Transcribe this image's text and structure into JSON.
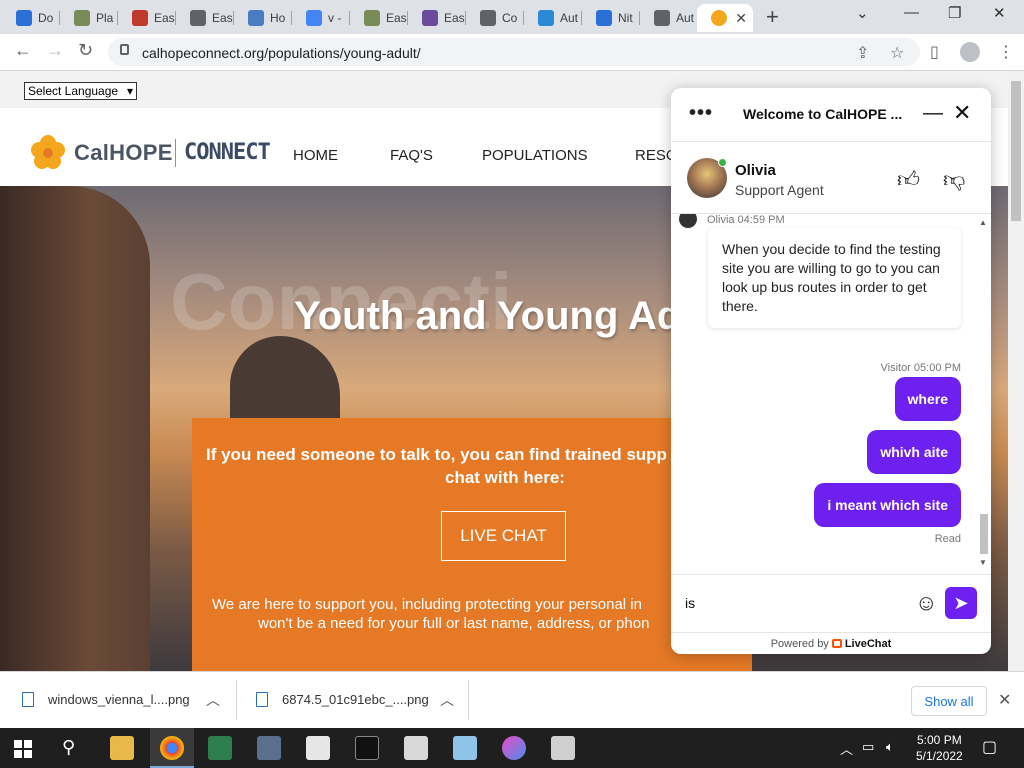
{
  "browser": {
    "tabs": [
      {
        "label": "Do",
        "color": "#2a6fd6",
        "icon": "app-icon"
      },
      {
        "label": "Pla",
        "color": "#7a8b5a",
        "icon": "game-icon"
      },
      {
        "label": "Eas",
        "color": "#c0392b",
        "icon": "game-icon"
      },
      {
        "label": "Eas",
        "color": "#5f6368",
        "icon": "globe-icon"
      },
      {
        "label": "Ho",
        "color": "#4a7cc4",
        "icon": "app-icon"
      },
      {
        "label": "v -",
        "color": "#4285f4",
        "icon": "google-icon"
      },
      {
        "label": "Eas",
        "color": "#7a8b5a",
        "icon": "game-icon"
      },
      {
        "label": "Eas",
        "color": "#6a4c9c",
        "icon": "game-icon"
      },
      {
        "label": "Co",
        "color": "#5f6368",
        "icon": "globe-icon"
      },
      {
        "label": "Aut",
        "color": "#2a8ad6",
        "icon": "app-icon"
      },
      {
        "label": "Nit",
        "color": "#2a6fd6",
        "icon": "flame-icon"
      },
      {
        "label": "Aut",
        "color": "#5f6368",
        "icon": "globe-icon"
      }
    ],
    "active_tab_color": "#f4a71d",
    "url": "calhopeconnect.org/populations/young-adult/"
  },
  "page": {
    "language_select": "Select Language",
    "logo_text": "CalHOPE",
    "logo_connect": "CONNECT",
    "nav": [
      "HOME",
      "FAQ'S",
      "POPULATIONS",
      "RESO"
    ],
    "hero_ghost": "Connecti",
    "hero_title": "Youth and Young Adu",
    "orange_line1": "If you need someone to talk to, you can find trained supp",
    "orange_line2": "chat with here:",
    "live_chat_button": "LIVE CHAT",
    "orange_sub1": "We are here to support you, including protecting your personal in",
    "orange_sub2": "won't be a need for your full or last name, address, or phon",
    "accent": "#e57926"
  },
  "chat": {
    "title": "Welcome to CalHOPE ...",
    "agent_name": "Olivia",
    "agent_role": "Support Agent",
    "agent_meta": "Olivia 04:59 PM",
    "agent_message": "When you decide to find the testing site you are willing to go to you can look up bus routes in order to get there.",
    "visitor_meta": "Visitor 05:00 PM",
    "visitor_messages": [
      "where",
      "whivh aite",
      "i meant which site"
    ],
    "read_status": "Read",
    "composer_value": "is",
    "powered_by": "Powered by",
    "brand": "LiveChat",
    "accent": "#6e20f0"
  },
  "downloads": {
    "items": [
      "windows_vienna_l....png",
      "6874.5_01c91ebc_....png"
    ],
    "show_all": "Show all"
  },
  "taskbar": {
    "time": "5:00 PM",
    "date": "5/1/2022"
  }
}
